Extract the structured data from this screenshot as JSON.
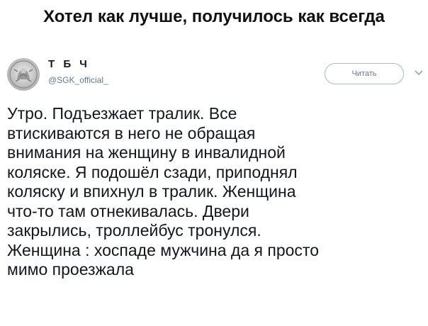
{
  "meme": {
    "title": "Хотел как лучше, получилось как всегда"
  },
  "tweet": {
    "author": {
      "name": "Т Б Ч",
      "handle": "@SGK_official_"
    },
    "follow_label": "Читать",
    "icons": {
      "avatar": "avatar-emblem-icon",
      "more": "chevron-down-icon"
    },
    "text": "Утро. Подъезжает тралик. Все\nвтискиваются в него не обращая\nвнимания на женщину в инвалидной\nколяске. Я подошёл сзади, приподнял\nколяску и впихнул в тралик. Женщина\nчто-то там отнекивалась. Двери\nзакрылись, троллейбус тронулся.\nЖенщина : хоспаде мужчина да я просто\nмимо проезжала"
  },
  "colors": {
    "text": "#14171a",
    "secondary": "#657786",
    "button_border": "#aab8c2"
  }
}
